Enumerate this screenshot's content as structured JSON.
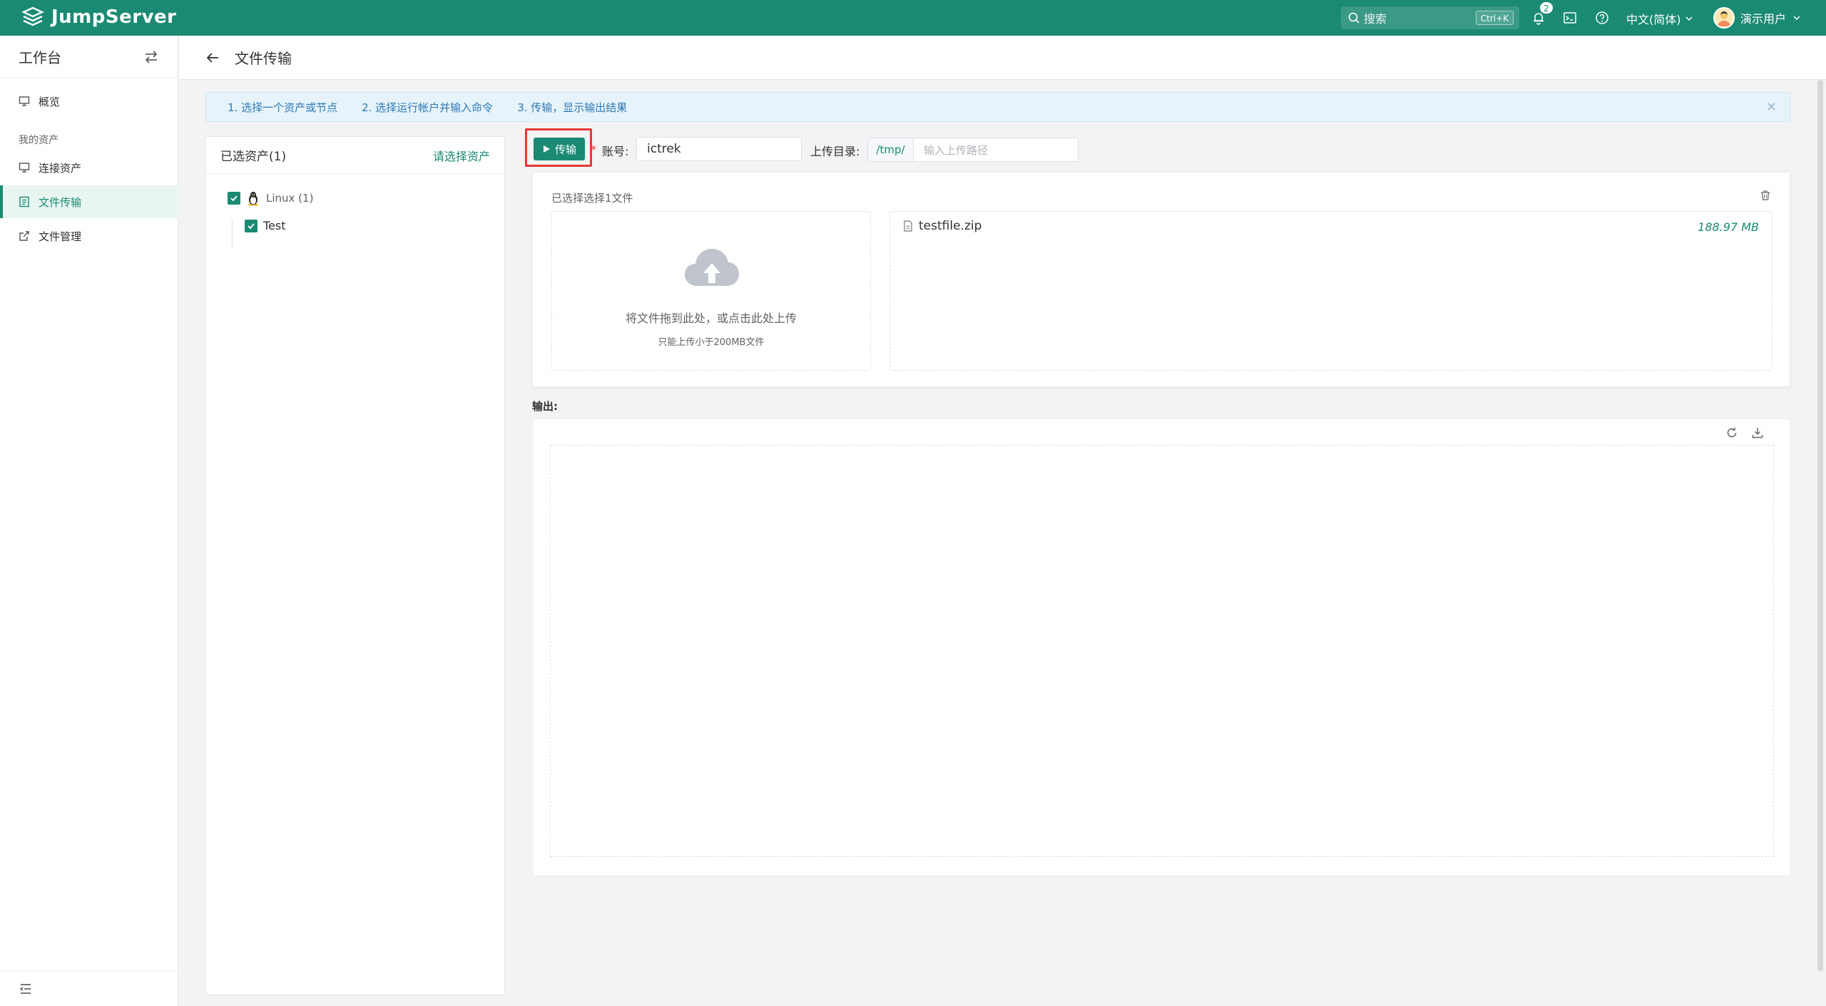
{
  "header": {
    "brand": "JumpServer",
    "search_placeholder": "搜索",
    "search_shortcut": "Ctrl+K",
    "notification_count": "2",
    "language": "中文(简体)",
    "user_name": "演示用户"
  },
  "sidebar": {
    "title": "工作台",
    "items": [
      {
        "label": "概览"
      },
      {
        "label": "连接资产"
      },
      {
        "label": "文件传输"
      },
      {
        "label": "文件管理"
      }
    ],
    "group_label": "我的资产"
  },
  "page": {
    "title": "文件传输"
  },
  "steps": [
    "1. 选择一个资产或节点",
    "2. 选择运行帐户并输入命令",
    "3. 传输，显示输出结果"
  ],
  "asset_panel": {
    "title": "已选资产(1)",
    "select_link": "请选择资产",
    "tree": {
      "node": "Linux (1)",
      "child": "Test"
    }
  },
  "toolbar": {
    "transfer_button": "传输",
    "required_mark": "*",
    "account_label": "账号:",
    "account_value": "ictrek",
    "upload_dir_label": "上传目录:",
    "dir_prefix": "/tmp/",
    "dir_placeholder": "输入上传路径"
  },
  "upload": {
    "selected_title": "已选择选择1文件",
    "drop_text": "将文件拖到此处，或点击此处上传",
    "size_tip": "只能上传小于200MB文件",
    "files": [
      {
        "name": "testfile.zip",
        "size": "188.97 MB"
      }
    ]
  },
  "output": {
    "label": "输出:"
  },
  "colors": {
    "brand": "#1a8a73",
    "highlight_box": "#e53935",
    "info_text": "#2d79b4"
  }
}
